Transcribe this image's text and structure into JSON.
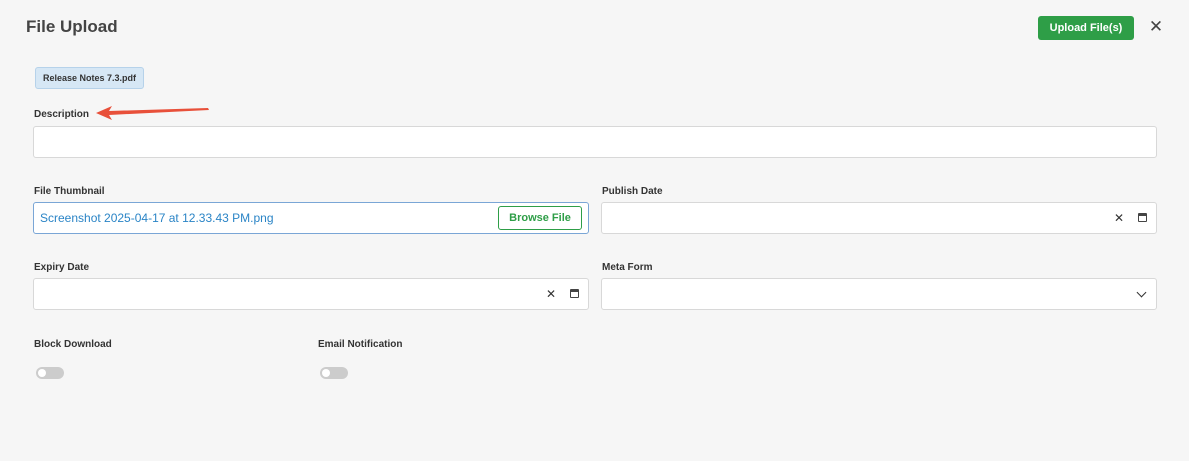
{
  "header": {
    "title": "File Upload",
    "upload_label": "Upload File(s)",
    "close_glyph": "✕"
  },
  "attachment": {
    "file_name": "Release Notes 7.3.pdf"
  },
  "form": {
    "description": {
      "label": "Description",
      "value": ""
    },
    "file_thumbnail": {
      "label": "File Thumbnail",
      "value": "Screenshot 2025-04-17 at 12.33.43 PM.png",
      "browse_label": "Browse File"
    },
    "publish_date": {
      "label": "Publish Date",
      "value": ""
    },
    "expiry_date": {
      "label": "Expiry Date",
      "value": ""
    },
    "meta_form": {
      "label": "Meta Form",
      "value": ""
    },
    "block_download": {
      "label": "Block Download",
      "enabled": false
    },
    "email_notification": {
      "label": "Email Notification",
      "enabled": false
    },
    "clear_glyph": "✕"
  },
  "icons": {
    "close": "close-icon",
    "clear": "clear-icon",
    "calendar": "calendar-icon",
    "chevron": "chevron-down-icon",
    "annotation": "annotation-arrow-icon"
  },
  "colors": {
    "primary": "#2e9e47",
    "link": "#2a84c6",
    "chip_bg": "#d6e7f5",
    "annotation": "#e8503a"
  }
}
